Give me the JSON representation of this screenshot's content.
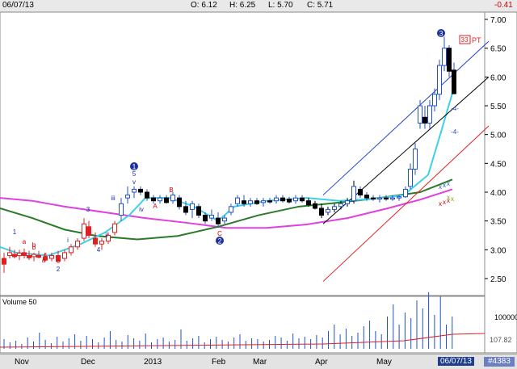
{
  "header": {
    "date": "06/07/13",
    "open": "O: 6.12",
    "high": "H: 6.25",
    "low": "L: 5.70",
    "close": "C: 5.71",
    "change": "-0.41"
  },
  "chart_data": {
    "type": "candlestick",
    "yticks": [
      "7.00",
      "6.50",
      "6.00",
      "5.50",
      "5.00",
      "4.50",
      "4.00",
      "3.50",
      "3.00",
      "2.50"
    ],
    "ylim": [
      2.2,
      7.2
    ],
    "months": [
      "Nov",
      "Dec",
      "2013",
      "Feb",
      "Mar",
      "Apr",
      "May"
    ],
    "wave_labels": {
      "w1": "1",
      "w2": "2",
      "w3": "3",
      "sub": [
        "1",
        "a",
        "b",
        "c",
        "2",
        "3",
        "4",
        "5",
        "v",
        "iv",
        "iii",
        "ii",
        "i",
        "A",
        "B",
        "C",
        "a",
        "b",
        "c"
      ]
    },
    "target_label": "PT",
    "target_badge": "33",
    "annotations": [
      "-4-",
      "-4-"
    ],
    "volume": {
      "title": "Volume 50",
      "tick": "100000",
      "value": "107.82"
    }
  },
  "footer": {
    "current_date": "06/07/13",
    "symbol": "#4383"
  },
  "colors": {
    "price_axis_bg": "#ffffff",
    "ma_pink": "#e040e0",
    "ma_green": "#2a7a2a",
    "ma_cyan": "#3fd0e8",
    "channel_blue": "#2040d0",
    "channel_red": "#e02020",
    "channel_black": "#000000",
    "up_candle": "#ffffff",
    "bar_blue": "#2050d0",
    "bar_red": "#e02020"
  }
}
